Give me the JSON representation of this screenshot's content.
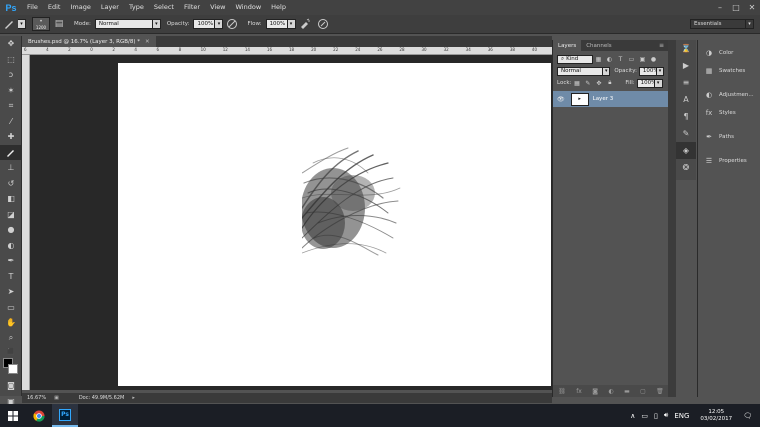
{
  "app": {
    "logo": "Ps"
  },
  "menu": [
    "File",
    "Edit",
    "Image",
    "Layer",
    "Type",
    "Select",
    "Filter",
    "View",
    "Window",
    "Help"
  ],
  "window_controls": [
    "–",
    "□",
    "✕"
  ],
  "options_bar": {
    "brush_size": "1200",
    "mode_label": "Mode:",
    "mode_value": "Normal",
    "opacity_label": "Opacity:",
    "opacity_value": "100%",
    "flow_label": "Flow:",
    "flow_value": "100%",
    "workspace": "Essentials"
  },
  "document": {
    "tab_title": "Brushes.psd @ 16.7% (Layer 3, RGB/8) *",
    "ruler_ticks": [
      "6",
      "4",
      "2",
      "0",
      "2",
      "4",
      "6",
      "8",
      "10",
      "12",
      "14",
      "16",
      "18",
      "20",
      "22",
      "24",
      "26",
      "28",
      "30",
      "32",
      "34",
      "36",
      "38",
      "40"
    ],
    "zoom": "16.67%",
    "doc_info": "Doc: 49.9M/5.62M"
  },
  "layers_panel": {
    "tabs": [
      "Layers",
      "Channels"
    ],
    "filter_kind": "Kind",
    "blend_mode": "Normal",
    "opacity_label": "Opacity:",
    "opacity_value": "100%",
    "lock_label": "Lock:",
    "fill_label": "Fill:",
    "fill_value": "100%",
    "layer_name": "Layer 3"
  },
  "mini_panels": [
    "Color",
    "Swatches",
    "Adjustmen...",
    "Styles",
    "Paths",
    "Properties"
  ],
  "taskbar": {
    "lang": "ENG",
    "time": "12:05",
    "date": "03/02/2017"
  },
  "colors": {
    "accent": "#31a8ff",
    "layer_selected": "#6f8ba8",
    "canvas": "#ffffff"
  }
}
